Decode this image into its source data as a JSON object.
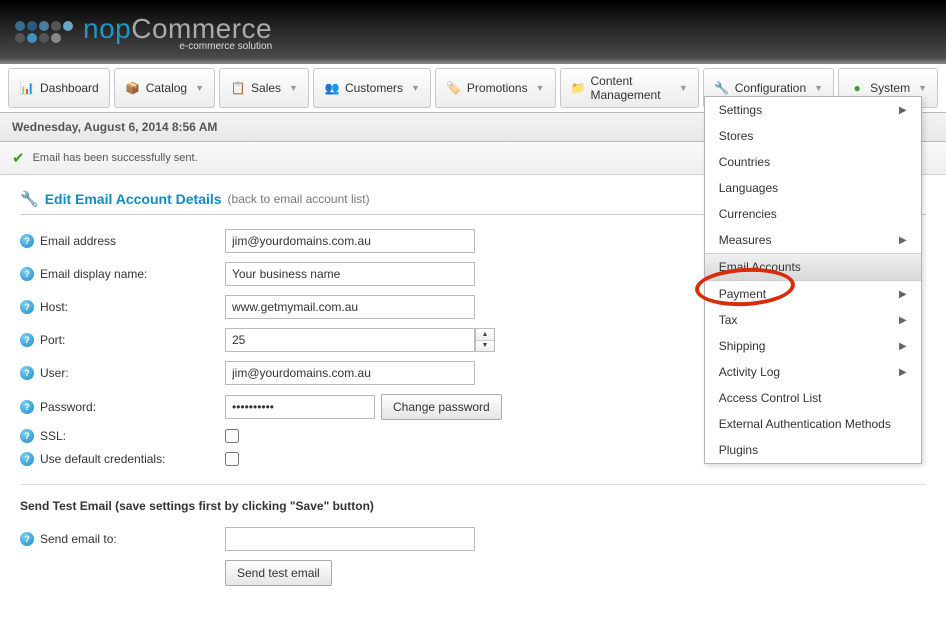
{
  "logo": {
    "nop": "nop",
    "commerce": "Commerce",
    "sub": "e-commerce solution"
  },
  "menu": {
    "dashboard": "Dashboard",
    "catalog": "Catalog",
    "sales": "Sales",
    "customers": "Customers",
    "promotions": "Promotions",
    "content": "Content Management",
    "configuration": "Configuration",
    "system": "System"
  },
  "dropdown": {
    "settings": "Settings",
    "stores": "Stores",
    "countries": "Countries",
    "languages": "Languages",
    "currencies": "Currencies",
    "measures": "Measures",
    "emailAccounts": "Email Accounts",
    "payment": "Payment",
    "tax": "Tax",
    "shipping": "Shipping",
    "activityLog": "Activity Log",
    "acl": "Access Control List",
    "extAuth": "External Authentication Methods",
    "plugins": "Plugins"
  },
  "dateBar": "Wednesday, August 6, 2014 8:56 AM",
  "successMsg": "Email has been successfully sent.",
  "page": {
    "title": "Edit Email Account Details",
    "back": "(back to email account list)"
  },
  "form": {
    "emailAddressLabel": "Email address",
    "emailAddressValue": "jim@yourdomains.com.au",
    "displayNameLabel": "Email display name:",
    "displayNameValue": "Your business name",
    "hostLabel": "Host:",
    "hostValue": "www.getmymail.com.au",
    "portLabel": "Port:",
    "portValue": "25",
    "userLabel": "User:",
    "userValue": "jim@yourdomains.com.au",
    "passwordLabel": "Password:",
    "passwordValue": "••••••••••",
    "changePassword": "Change password",
    "sslLabel": "SSL:",
    "defaultCredLabel": "Use default credentials:"
  },
  "test": {
    "header": "Send Test Email (save settings first by clicking \"Save\" button)",
    "label": "Send email to:",
    "value": "",
    "button": "Send test email"
  }
}
